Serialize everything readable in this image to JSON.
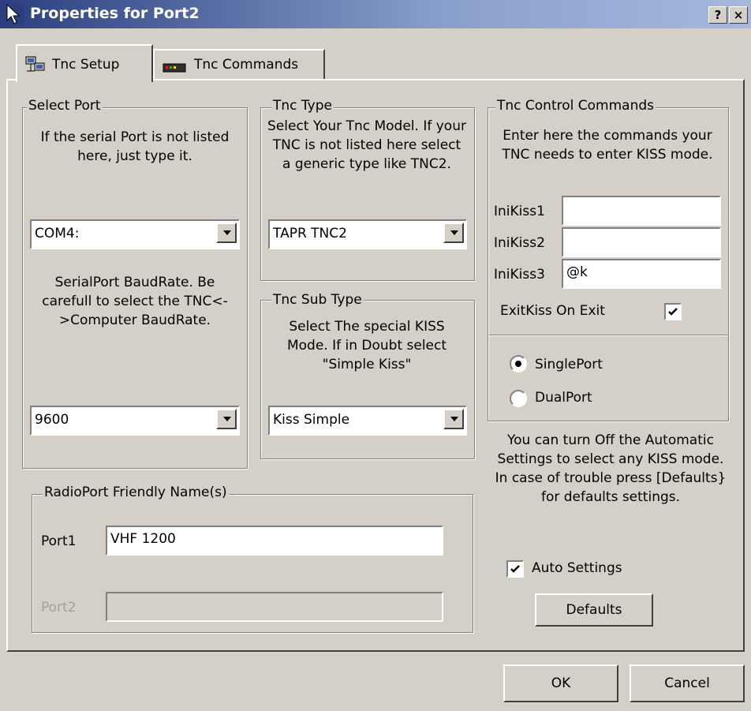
{
  "window": {
    "title": "Properties for Port2",
    "help_label": "?",
    "close_label": "×"
  },
  "tabs": [
    {
      "label": "Tnc Setup",
      "icon": "network-icon",
      "active": true
    },
    {
      "label": "Tnc Commands",
      "icon": "tnc-device-icon",
      "active": false
    }
  ],
  "select_port": {
    "legend": "Select Port",
    "hint": "If the serial Port is not listed here, just type it.",
    "port_value": "COM4:",
    "baud_hint": "SerialPort BaudRate. Be carefull to select the TNC<->Computer BaudRate.",
    "baud_value": "9600"
  },
  "tnc_type": {
    "legend": "Tnc Type",
    "hint": "Select Your Tnc Model. If your TNC is not listed here select a generic type like TNC2.",
    "value": "TAPR TNC2"
  },
  "tnc_sub_type": {
    "legend": "Tnc Sub Type",
    "hint": "Select The special KISS Mode. If in Doubt select \"Simple Kiss\"",
    "value": "Kiss Simple"
  },
  "tnc_control": {
    "legend": "Tnc Control Commands",
    "hint": "Enter here the commands your TNC needs to enter KISS mode.",
    "inikiss1_label": "IniKiss1",
    "inikiss1_value": "",
    "inikiss2_label": "IniKiss2",
    "inikiss2_value": "",
    "inikiss3_label": "IniKiss3",
    "inikiss3_value": "@k",
    "exitkiss_label": "ExitKiss On Exit",
    "exitkiss_checked": true
  },
  "port_mode": {
    "single_label": "SinglePort",
    "dual_label": "DualPort",
    "selected": "SinglePort"
  },
  "auto": {
    "hint": "You can turn Off the Automatic Settings to select any KISS mode. In case of trouble press [Defaults} for defaults settings.",
    "auto_label": "Auto Settings",
    "auto_checked": true,
    "defaults_label": "Defaults"
  },
  "friendly_names": {
    "legend": "RadioPort Friendly Name(s)",
    "port1_label": "Port1",
    "port1_value": "VHF 1200",
    "port2_label": "Port2",
    "port2_value": ""
  },
  "footer": {
    "ok_label": "OK",
    "cancel_label": "Cancel"
  },
  "colors": {
    "titlebar_start": "#2b3f7f",
    "titlebar_end": "#a6b8de",
    "face": "#d4d0c8"
  }
}
